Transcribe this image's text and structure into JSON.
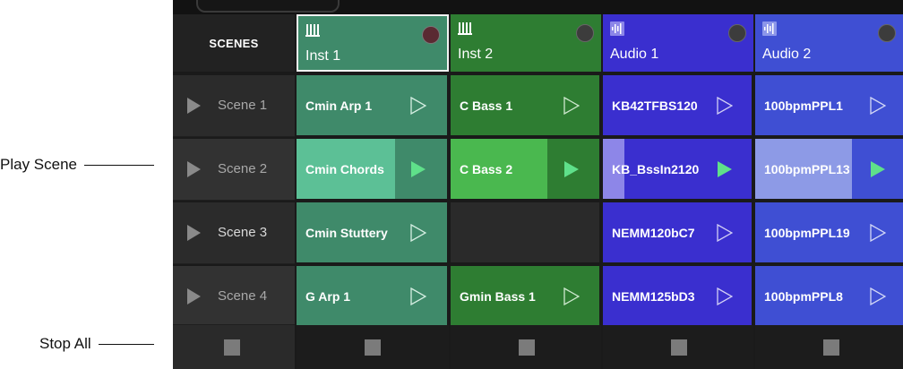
{
  "callouts": {
    "play_scene": "Play Scene",
    "stop_all": "Stop All"
  },
  "scenes_header": "SCENES",
  "tracks": [
    {
      "name": "Inst 1",
      "type_icon": "piano-keys-icon",
      "color": "#3f8a6a",
      "selected": true
    },
    {
      "name": "Inst 2",
      "type_icon": "piano-keys-icon",
      "color": "#2e7d32",
      "selected": false
    },
    {
      "name": "Audio 1",
      "type_icon": "audio-waveform-icon",
      "color": "#3a2fcf",
      "selected": false
    },
    {
      "name": "Audio 2",
      "type_icon": "audio-waveform-icon",
      "color": "#3f4fd3",
      "selected": false
    }
  ],
  "scenes": [
    {
      "label": "Scene 1"
    },
    {
      "label": "Scene 2"
    },
    {
      "label": "Scene 3"
    },
    {
      "label": "Scene 4"
    }
  ],
  "clips": {
    "inst1": [
      "Cmin Arp 1",
      "Cmin Chords",
      "Cmin Stuttery",
      "G Arp 1"
    ],
    "inst2": [
      "C Bass 1",
      "C Bass 2",
      "",
      "Gmin Bass 1"
    ],
    "audio1": [
      "KB42TFBS120",
      "KB_BssIn2120",
      "NEMM120bC7",
      "NEMM125bD3"
    ],
    "audio2": [
      "100bpmPPL1",
      "100bpmPPL13",
      "100bpmPPL19",
      "100bpmPPL8"
    ]
  },
  "playing_scene_index": 1,
  "colors": {
    "inst1_clip": "#3f8a6a",
    "inst1_playing": "#5cc096",
    "inst2_clip": "#2e7d32",
    "inst2_playing": "#4ab84f",
    "audio1_clip": "#3a2fcf",
    "audio2_clip": "#3f4fd3",
    "audio2_playing": "#8d9ae6",
    "play_active": "#5fe08a"
  }
}
